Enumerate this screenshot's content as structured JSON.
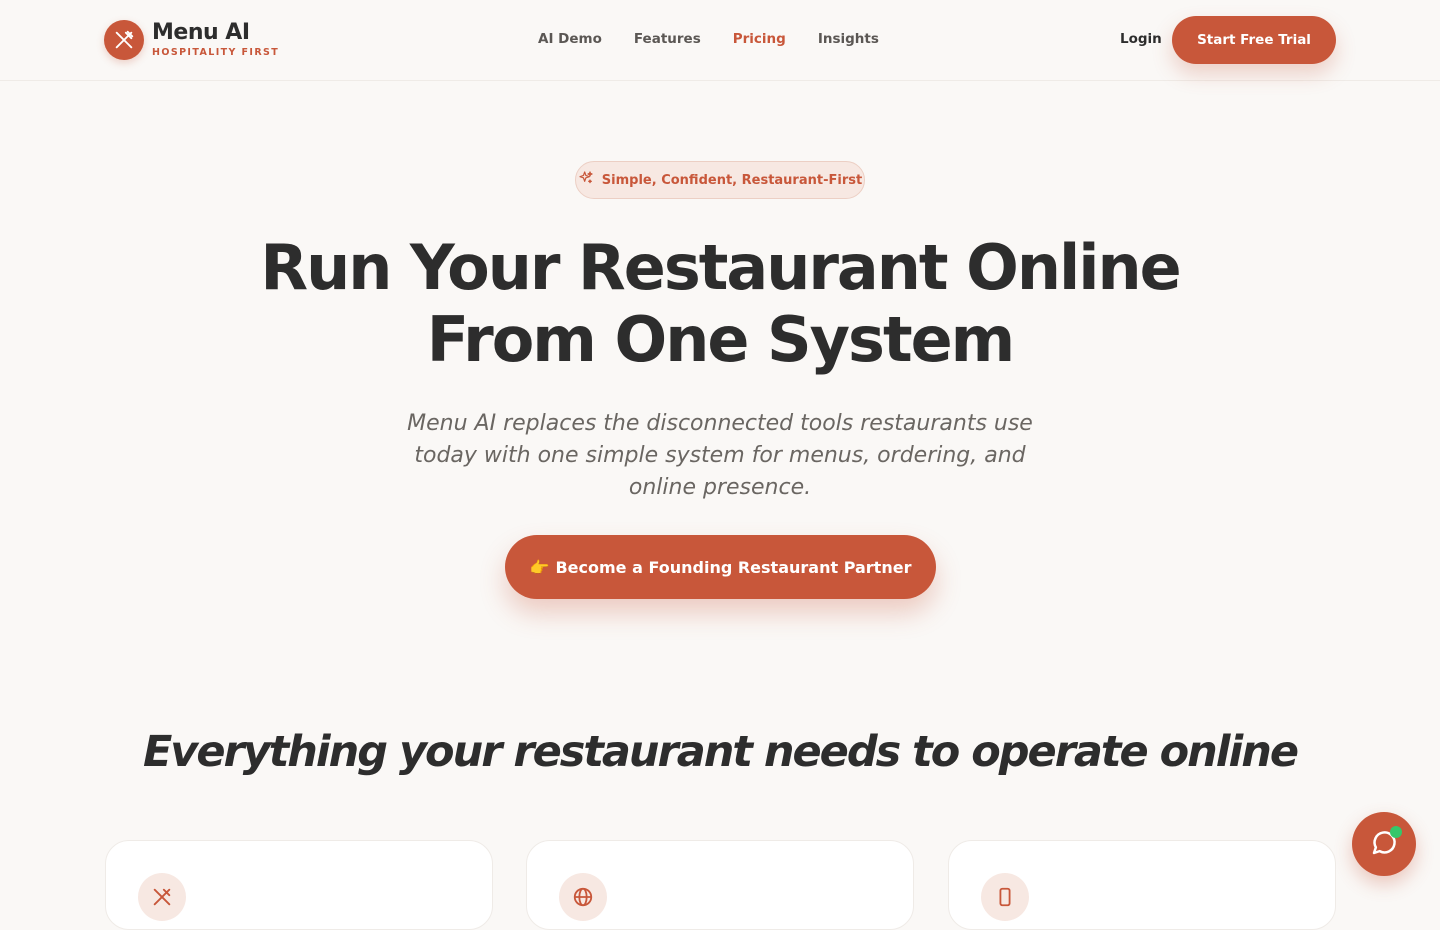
{
  "brand": {
    "name": "Menu AI",
    "tagline": "HOSPITALITY FIRST",
    "logo_icon": "utensils-icon"
  },
  "nav": {
    "items": [
      {
        "label": "AI Demo",
        "active": false
      },
      {
        "label": "Features",
        "active": false
      },
      {
        "label": "Pricing",
        "active": true
      },
      {
        "label": "Insights",
        "active": false
      }
    ],
    "login_label": "Login",
    "trial_label": "Start Free Trial"
  },
  "hero": {
    "badge_label": "Simple, Confident, Restaurant-First",
    "badge_icon": "sparkles-icon",
    "title_line1": "Run Your Restaurant Online",
    "title_line2": "From One System",
    "subtitle": "Menu AI replaces the disconnected tools restaurants use today with one simple system for menus, ordering, and online presence.",
    "cta_emoji": "👉",
    "cta_label": "Become a Founding Restaurant Partner"
  },
  "features": {
    "title": "Everything your restaurant needs to operate online",
    "cards": [
      {
        "icon": "utensils-icon"
      },
      {
        "icon": "globe-icon"
      },
      {
        "icon": "smartphone-icon"
      }
    ]
  },
  "chat": {
    "icon": "chat-bubble-icon",
    "status": "online"
  },
  "colors": {
    "accent": "#c8573a",
    "background": "#faf8f6",
    "text": "#2d2d2d",
    "online": "#35c66a"
  }
}
